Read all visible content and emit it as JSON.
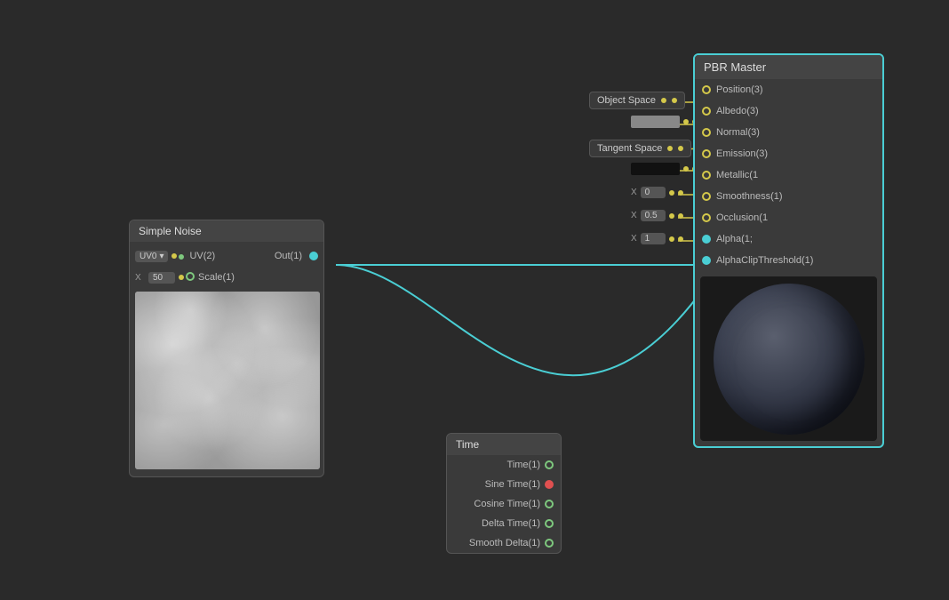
{
  "nodes": {
    "simple_noise": {
      "title": "Simple Noise",
      "uv_label": "UV0",
      "uv_socket_label": "UV(2)",
      "scale_label": "Scale(1)",
      "out_label": "Out(1)",
      "scale_value": "50"
    },
    "pbr_master": {
      "title": "PBR Master",
      "inputs": [
        {
          "label": "Position(3)",
          "socket": "yellow"
        },
        {
          "label": "Albedo(3)",
          "socket": "yellow"
        },
        {
          "label": "Normal(3)",
          "socket": "yellow"
        },
        {
          "label": "Emission(3)",
          "socket": "yellow"
        },
        {
          "label": "Metallic(1",
          "socket": "yellow"
        },
        {
          "label": "Smoothness(1)",
          "socket": "yellow"
        },
        {
          "label": "Occlusion(1",
          "socket": "yellow"
        },
        {
          "label": "Alpha(1;",
          "socket": "cyan"
        },
        {
          "label": "AlphaClipThreshold(1)",
          "socket": "cyan"
        }
      ]
    },
    "time": {
      "title": "Time",
      "outputs": [
        {
          "label": "Time(1)",
          "socket": "white"
        },
        {
          "label": "Sine Time(1)",
          "socket": "red"
        },
        {
          "label": "Cosine Time(1)",
          "socket": "white"
        },
        {
          "label": "Delta Time(1)",
          "socket": "white"
        },
        {
          "label": "Smooth Delta(1)",
          "socket": "white"
        }
      ]
    },
    "object_space": {
      "label": "Object Space"
    },
    "tangent_space": {
      "label": "Tangent Space"
    },
    "value_rows": [
      {
        "value": "",
        "is_color": true,
        "color": "#888"
      },
      {
        "value": "",
        "is_color": true,
        "color": "#000"
      },
      {
        "x_label": "X",
        "value": "0"
      },
      {
        "x_label": "X",
        "value": "0.5"
      },
      {
        "x_label": "X",
        "value": "1"
      }
    ]
  }
}
